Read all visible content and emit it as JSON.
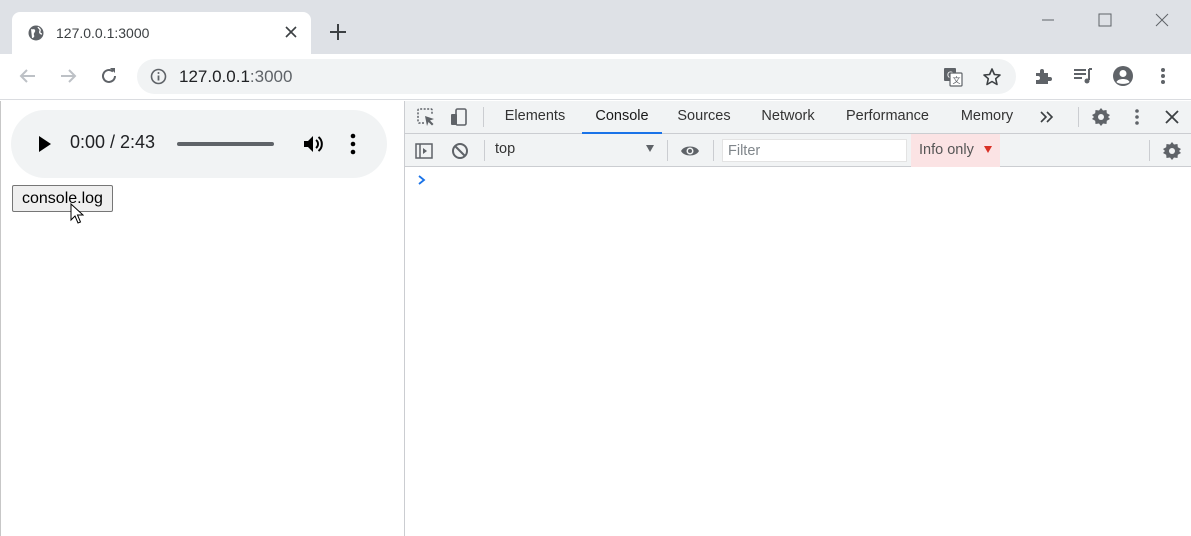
{
  "browser": {
    "tab": {
      "title": "127.0.0.1:3000",
      "icon": "globe-icon"
    },
    "new_tab_icon": "plus-icon",
    "window_controls": [
      "minimize-icon",
      "maximize-icon",
      "close-icon"
    ],
    "omnibox": {
      "url_host": "127.0.0.1",
      "url_port": ":3000"
    },
    "toolbar_icons": [
      "translate-icon",
      "bookmark-star-icon",
      "extensions-icon",
      "media-queue-icon",
      "profile-icon",
      "menu-icon"
    ]
  },
  "page": {
    "audio": {
      "time": "0:00 / 2:43"
    },
    "button_label": "console.log"
  },
  "devtools": {
    "tabs": [
      "Elements",
      "Console",
      "Sources",
      "Network",
      "Performance",
      "Memory"
    ],
    "active_tab": "Console",
    "context": "top",
    "filter_placeholder": "Filter",
    "levels": "Info only",
    "accent_color": "#1a73e8"
  }
}
